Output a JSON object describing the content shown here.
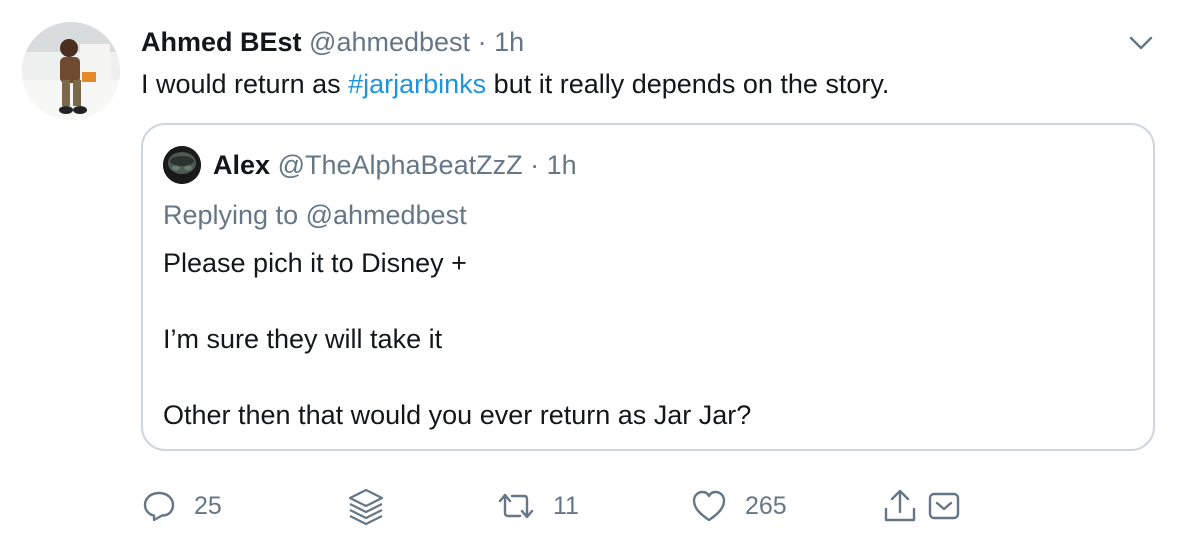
{
  "author": {
    "name": "Ahmed BEst",
    "handle": "@ahmedbest",
    "separator": "·",
    "time": "1h"
  },
  "tweet": {
    "text_before": "I would return as ",
    "hashtag": "#jarjarbinks",
    "text_after": " but it really depends on the story."
  },
  "quoted": {
    "name": "Alex",
    "handle": "@TheAlphaBeatZzZ",
    "separator": "·",
    "time": "1h",
    "replying_to": "Replying to @ahmedbest",
    "lines": [
      "Please pich it to Disney +",
      "I’m sure they will take it",
      "Other then that would you ever return as Jar Jar?"
    ]
  },
  "actions": {
    "replies": "25",
    "retweets": "11",
    "likes": "265"
  },
  "colors": {
    "link": "#1b95e0",
    "muted": "#657786",
    "border": "#ccd6dd"
  },
  "icons": [
    "chevron-down-icon",
    "reply-icon",
    "stack-icon",
    "retweet-icon",
    "heart-icon",
    "share-icon",
    "email-icon"
  ]
}
